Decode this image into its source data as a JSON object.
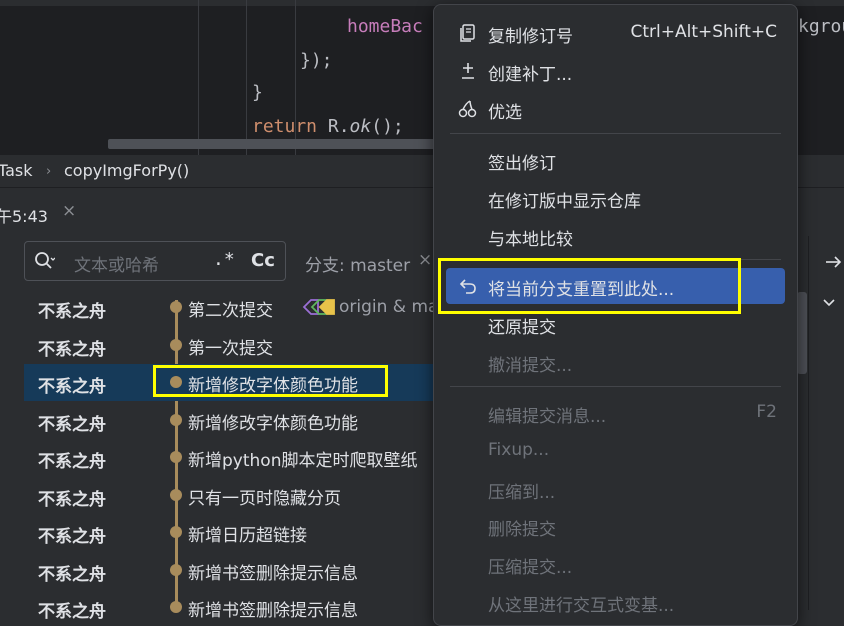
{
  "editor": {
    "lines": [
      {
        "indent": "homeBac",
        "type": "purple"
      },
      {
        "text": "});"
      },
      {
        "text": "}"
      },
      {
        "kw": "return",
        "obj": " R.",
        "method": "ok",
        "tail": "();"
      }
    ],
    "overflow_text": "kgrou"
  },
  "breadcrumb": {
    "items": [
      "Task",
      "copyImgForPy()"
    ],
    "separator": "›"
  },
  "git_tab": {
    "time": "午5:43",
    "close": "×"
  },
  "log_toolbar": {
    "search_placeholder": "文本或哈希",
    "regex_label": ".*",
    "case_label": "Cc",
    "branch_filter": "分支: master",
    "branch_filter_close": "×"
  },
  "commits": [
    {
      "author": "不系之舟",
      "message": "第二次提交"
    },
    {
      "author": "不系之舟",
      "message": "第一次提交"
    },
    {
      "author": "不系之舟",
      "message": "新增修改字体颜色功能"
    },
    {
      "author": "不系之舟",
      "message": "新增修改字体颜色功能"
    },
    {
      "author": "不系之舟",
      "message": "新增python脚本定时爬取壁纸"
    },
    {
      "author": "不系之舟",
      "message": "只有一页时隐藏分页"
    },
    {
      "author": "不系之舟",
      "message": "新增日历超链接"
    },
    {
      "author": "不系之舟",
      "message": "新增书签删除提示信息"
    },
    {
      "author": "不系之舟",
      "message": "新增书签删除提示信息"
    }
  ],
  "refs": {
    "label": "origin & ma"
  },
  "context_menu": {
    "items": [
      {
        "label": "复制修订号",
        "shortcut": "Ctrl+Alt+Shift+C",
        "icon": "copy-icon"
      },
      {
        "label": "创建补丁...",
        "icon": "patch-icon"
      },
      {
        "label": "优选",
        "icon": "cherry-pick-icon"
      },
      {
        "label": "签出修订"
      },
      {
        "label": "在修订版中显示仓库"
      },
      {
        "label": "与本地比较"
      },
      {
        "label": "将当前分支重置到此处...",
        "icon": "undo-icon"
      },
      {
        "label": "还原提交"
      },
      {
        "label": "撤消提交..."
      },
      {
        "label": "编辑提交消息...",
        "shortcut": "F2"
      },
      {
        "label": "Fixup..."
      },
      {
        "label": "压缩到..."
      },
      {
        "label": "删除提交"
      },
      {
        "label": "压缩提交..."
      },
      {
        "label": "从这里进行交互式变基..."
      }
    ]
  },
  "colors": {
    "accent": "#375fad",
    "selection": "#163a59",
    "highlight_box": "#ffff00",
    "graph": "#a88c5c"
  }
}
